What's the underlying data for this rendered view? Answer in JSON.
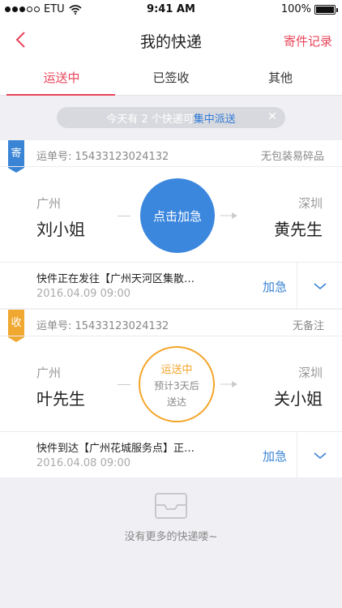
{
  "status_bar": {
    "carrier": "ETU",
    "time": "9:41 AM",
    "battery": "100%"
  },
  "nav": {
    "title": "我的快递",
    "right_label": "寄件记录"
  },
  "tabs": [
    {
      "label": "运送中",
      "active": true
    },
    {
      "label": "已签收"
    },
    {
      "label": "其他"
    }
  ],
  "notice": {
    "prefix": "今天有 2 个快递可",
    "highlight": "集中派送"
  },
  "cards": [
    {
      "tag": "寄",
      "waybill": "运单号: 15433123024132",
      "note": "无包装易碎品",
      "from_city": "广州",
      "from_person": "刘小姐",
      "to_city": "深圳",
      "to_person": "黄先生",
      "action_circle": "点击加急",
      "status_text": "快件正在发往【广州天河区集散…",
      "status_time": "2016.04.09 09:00",
      "urgent_label": "加急"
    },
    {
      "tag": "收",
      "waybill": "运单号: 15433123024132",
      "note": "无备注",
      "from_city": "广州",
      "from_person": "叶先生",
      "to_city": "深圳",
      "to_person": "关小姐",
      "circle_status": "运送中",
      "circle_line2": "预计3天后",
      "circle_line3": "送达",
      "status_text": "快件到达【广州花城服务点】正…",
      "status_time": "2016.04.08 09:00",
      "urgent_label": "加急"
    }
  ],
  "empty": {
    "text": "没有更多的快递喽~"
  },
  "colors": {
    "accent": "#e8445a",
    "blue": "#3a84d6",
    "orange": "#f3a52a"
  }
}
